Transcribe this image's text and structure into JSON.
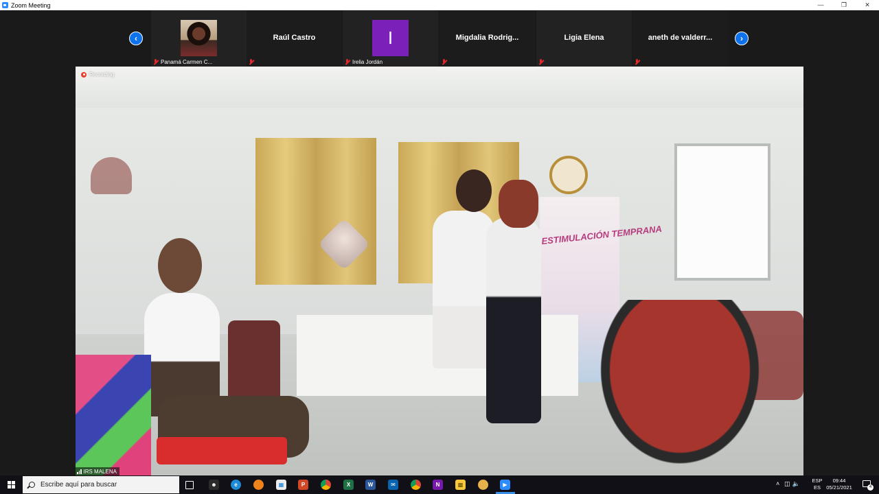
{
  "window": {
    "title": "Zoom Meeting",
    "controls": [
      "minimize",
      "restore",
      "close"
    ]
  },
  "participants": [
    {
      "name": "Panamá Carmen C...",
      "display": "photo",
      "muted": true
    },
    {
      "name": "Raúl Castro",
      "display": "name",
      "muted": true
    },
    {
      "name": "Irelia Jordán",
      "display": "letter",
      "initial": "I",
      "avatar_color": "#7b20b8",
      "muted": true
    },
    {
      "name": "Migdalia  Rodrig...",
      "display": "name",
      "muted": true
    },
    {
      "name": "Ligia Elena",
      "display": "name",
      "muted": true
    },
    {
      "name": "aneth  de valderr...",
      "display": "name",
      "muted": true
    }
  ],
  "main_video": {
    "recording_label": "Recording",
    "speaker_label": "IRS MALENA",
    "banner_text": "ESTIMULACIÓN TEMPRANA"
  },
  "taskbar": {
    "search_placeholder": "Escribe aquí para buscar",
    "apps": [
      "task-view",
      "people",
      "edge",
      "firefox",
      "store",
      "powerpoint",
      "chrome",
      "excel",
      "word",
      "mail",
      "chrome-profile",
      "onenote",
      "file-explorer",
      "media-app",
      "zoom"
    ],
    "language_top": "ESP",
    "language_bottom": "ES",
    "time": "09:44",
    "date": "05/21/2021",
    "notification_count": "4"
  },
  "colors": {
    "accent": "#0e72ed",
    "muted_mic": "#e02828",
    "recording": "#e8402d",
    "avatar_purple": "#7b20b8",
    "taskbar": "#101016"
  }
}
